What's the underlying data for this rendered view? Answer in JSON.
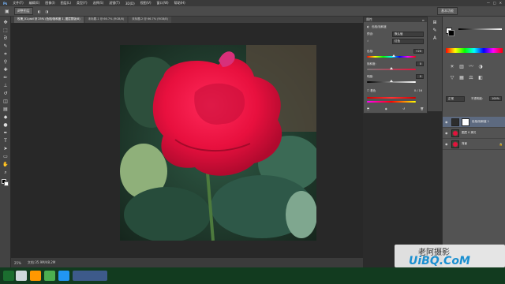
{
  "menubar": {
    "app_logo": "Ps",
    "items": [
      "文件(F)",
      "编辑(E)",
      "图像(I)",
      "图层(L)",
      "类型(Y)",
      "选择(S)",
      "滤镜(T)",
      "3D(D)",
      "视图(V)",
      "窗口(W)",
      "帮助(H)"
    ]
  },
  "options": {
    "mode": "调整图层",
    "workspace": "基本功能"
  },
  "tabs": [
    "玫瑰_01.psd @ 25% (色相/饱和度 1, 图层蒙版/8)",
    "未标题-1 @ 66.7% (RGB/8)",
    "未标题-2 @ 66.7% (RGB/8)"
  ],
  "properties": {
    "title": "属性",
    "adjustment": "色相/饱和度",
    "preset_label": "预设:",
    "preset_value": "默认值",
    "channel_value": "红色",
    "hue_label": "色相:",
    "hue_value": "+20",
    "saturation_label": "饱和度:",
    "saturation_value": "0",
    "lightness_label": "明度:",
    "lightness_value": "0",
    "colorize_label": "着色",
    "range_value": "0 / 16"
  },
  "status": {
    "zoom": "25%",
    "doc": "文档:35.9M/48.2M"
  },
  "layers": {
    "mode": "正常",
    "opacity_label": "不透明度:",
    "opacity_value": "100%",
    "items": [
      {
        "name": "色相/饱和度 1"
      },
      {
        "name": "图层 0 拷贝"
      },
      {
        "name": "背景"
      }
    ]
  },
  "watermark": {
    "site": "UiBQ.CoM",
    "account": "老阿摄影"
  },
  "colors": {
    "accent": "#e3123c",
    "panel": "#535353",
    "bg": "#282828"
  }
}
